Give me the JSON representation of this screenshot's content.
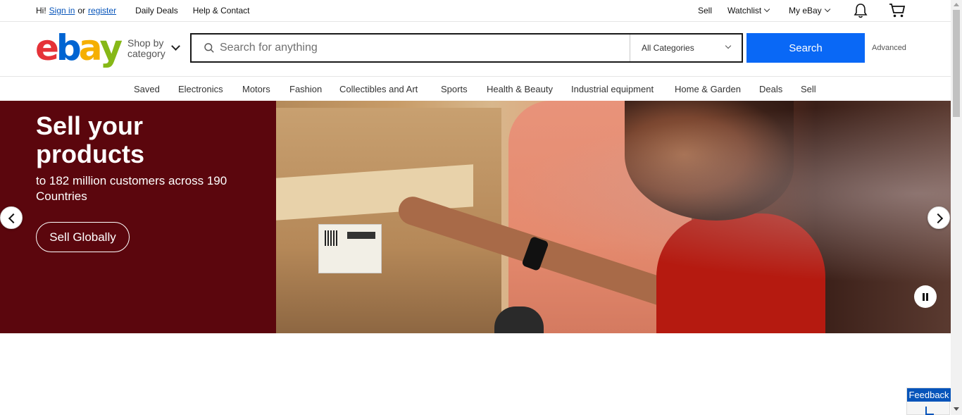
{
  "topbar": {
    "greeting": "Hi!",
    "sign_in": "Sign in",
    "or_text": "or",
    "register": "register",
    "daily_deals": "Daily Deals",
    "help_contact": "Help & Contact",
    "sell": "Sell",
    "watchlist": "Watchlist",
    "my_ebay": "My eBay",
    "icons": [
      "bell-icon",
      "cart-icon"
    ]
  },
  "header": {
    "logo_letters": [
      "e",
      "b",
      "a",
      "y"
    ],
    "logo_colors": [
      "#e53238",
      "#0064d2",
      "#f5af02",
      "#86b817"
    ],
    "shop_by_line1": "Shop by",
    "shop_by_line2": "category",
    "search_placeholder": "Search for anything",
    "category_selected": "All Categories",
    "search_button": "Search",
    "advanced": "Advanced"
  },
  "catnav": {
    "items": [
      "Saved",
      "Electronics",
      "Motors",
      "Fashion",
      "Collectibles and Art",
      "Sports",
      "Health & Beauty",
      "Industrial equipment",
      "Home & Garden",
      "Deals",
      "Sell"
    ]
  },
  "hero": {
    "title": "Sell your products",
    "subtitle": "to 182 million customers across 190 Countries",
    "cta": "Sell Globally",
    "background_color": "#5b060d"
  },
  "feedback": {
    "label": "Feedback"
  },
  "colors": {
    "accent": "#0968f6",
    "link": "#0654ba"
  }
}
